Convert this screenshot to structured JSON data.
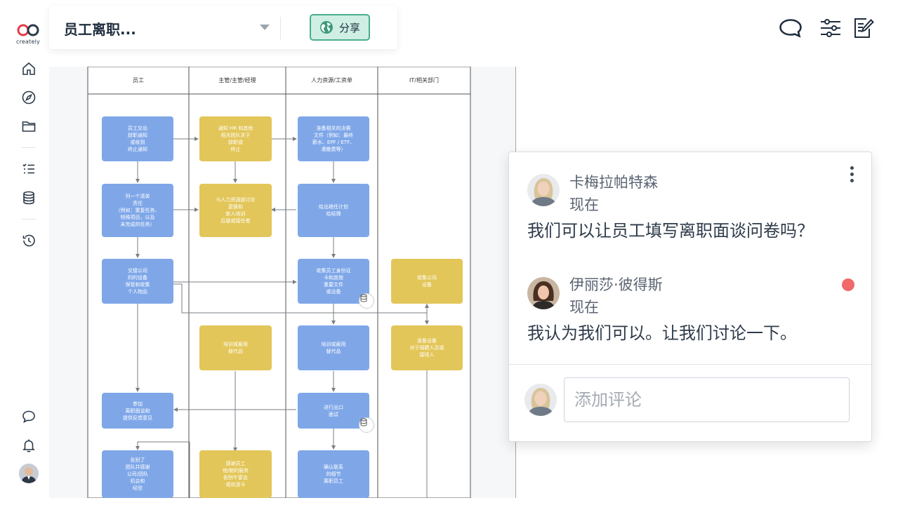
{
  "app": {
    "logo_text": "creately"
  },
  "topbar": {
    "doc_title": "员工离职...",
    "share_label": "分享"
  },
  "sidebar_icons": [
    "home-icon",
    "compass-icon",
    "folder-icon",
    "checklist-icon",
    "database-icon",
    "history-icon",
    "chat-icon",
    "bell-icon"
  ],
  "top_right_icons": [
    "comment-icon",
    "settings-sliders-icon",
    "edit-notes-icon"
  ],
  "diagram": {
    "lanes": [
      "员工",
      "主管/主管/经理",
      "人力资源/工资单",
      "IT/相关部门"
    ],
    "nodes": {
      "n1": "员工交出\n辞职通知\n或收到\n终止通知",
      "n2": "通知 HR 和其他\n相关团队关于\n辞职或\n终止",
      "n3": "准备相关的决赛\n文件（例如：最终\n薪水、EPF / ETF、\n遣散费等）",
      "n4": "列一个清单\n责任\n（例如：重复任务、\n特殊项目，以及\n未完成的任务）",
      "n5": "与人力资源部讨论\n更换和\n新入培训\n后替或接任者",
      "n6": "给出继任计划\n给经理",
      "n7": "交接公司\n的的设备\n保管和收集\n个人物品",
      "n8": "收集员工身份证\n卡和其他\n重要文件\n或设备",
      "n9": "收集公司\n设备",
      "n10": "培训或雇用\n替代品",
      "n11": "培训或雇用\n替代品",
      "n12": "准备设备\n对于填聘人员或\n接班人",
      "n13": "参加\n离职面谈和\n提供反馈意见",
      "n14": "进行出口\n面试",
      "n15": "告别了\n团队并感谢\n公司/团队\n机会和\n经验",
      "n16": "感谢员工\n他/她的服务\n告别午宴会\n或欢送卡",
      "n17": "确认联系\n的细节\n离职员工"
    }
  },
  "comments": {
    "items": [
      {
        "author": "卡梅拉帕特森",
        "time": "现在",
        "text": "我们可以让员工填写离职面谈问卷吗？"
      },
      {
        "author": "伊丽莎·彼得斯",
        "time": "现在",
        "text": "我认为我们可以。让我们讨论一下。"
      }
    ],
    "input_placeholder": "添加评论",
    "unread_color": "#f06a6a"
  },
  "colors": {
    "blue_node": "#7fa7e8",
    "yellow_node": "#e3c659",
    "share_bg": "#cfeee4",
    "share_border": "#4aae8e"
  }
}
